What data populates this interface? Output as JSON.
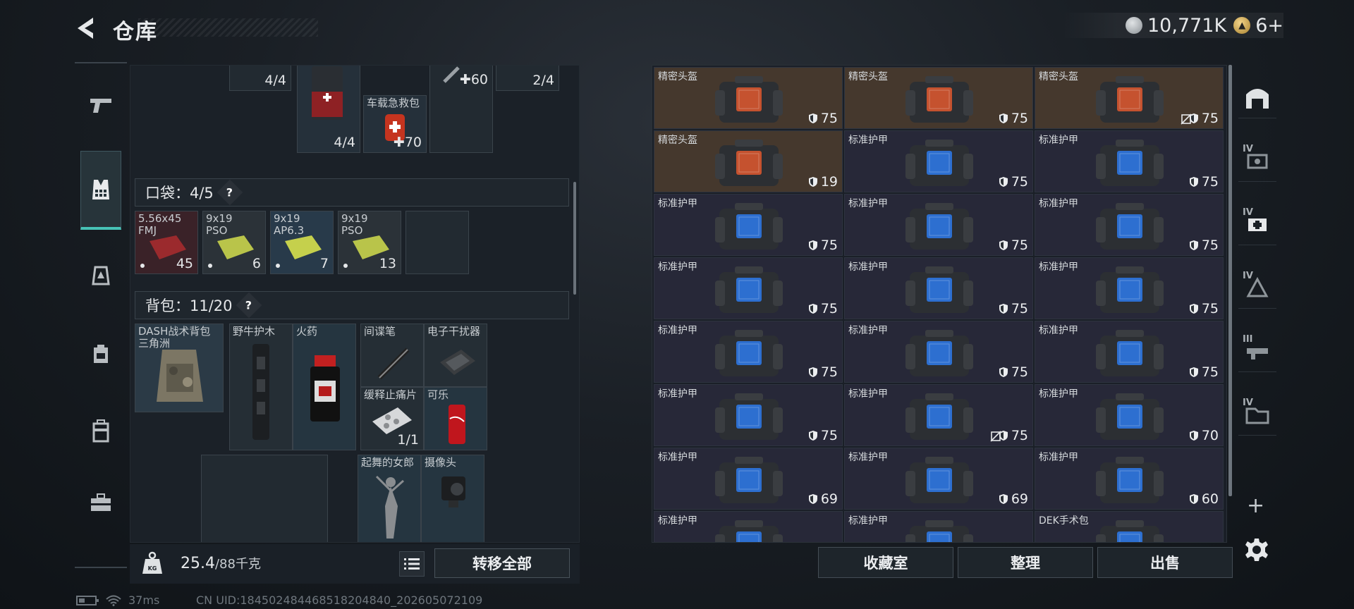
{
  "header": {
    "title": "仓库",
    "silver": "10,771K",
    "gold": "6+"
  },
  "left": {
    "top_slots": [
      {
        "count": "4/4"
      },
      {
        "count": "4/4"
      },
      {
        "label": "车载急救包",
        "count": "70"
      },
      {
        "count": "60"
      },
      {
        "count": "2/4"
      }
    ],
    "pocket": {
      "label": "口袋：",
      "count": "4/5",
      "help": "?"
    },
    "pocket_items": [
      {
        "label": "5.56x45\nFMJ",
        "count": "45",
        "color": "#3a2024"
      },
      {
        "label": "9x19\nPSO",
        "count": "6",
        "color": "#2a3034"
      },
      {
        "label": "9x19\nAP6.3",
        "count": "7",
        "color": "#273846"
      },
      {
        "label": "9x19\nPSO",
        "count": "13",
        "color": "#2a3034"
      }
    ],
    "backpack": {
      "label": "背包：",
      "count": "11/20",
      "help": "?"
    },
    "backpack_items": {
      "dash": "DASH战术背包\n三角洲",
      "handguard": "野牛护木",
      "gunpowder": "火药",
      "spy_pen": "间谍笔",
      "jammer": "电子干扰器",
      "painkiller": "缓释止痛片",
      "painkiller_count": "1/1",
      "cola": "可乐",
      "dancer": "起舞的女郎",
      "camera": "摄像头"
    },
    "weight": "25.4",
    "weight_unit": "/88千克",
    "transfer": "转移全部"
  },
  "right": {
    "cells": [
      {
        "name": "精密头盔",
        "val": "75",
        "kind": "helmet"
      },
      {
        "name": "精密头盔",
        "val": "75",
        "kind": "helmet"
      },
      {
        "name": "精密头盔",
        "val": "75",
        "kind": "helmet",
        "nosign": true
      },
      {
        "name": "精密头盔",
        "val": "19",
        "kind": "helmet"
      },
      {
        "name": "标准护甲",
        "val": "75",
        "kind": "armor"
      },
      {
        "name": "标准护甲",
        "val": "75",
        "kind": "armor"
      },
      {
        "name": "标准护甲",
        "val": "75",
        "kind": "armor"
      },
      {
        "name": "标准护甲",
        "val": "75",
        "kind": "armor"
      },
      {
        "name": "标准护甲",
        "val": "75",
        "kind": "armor"
      },
      {
        "name": "标准护甲",
        "val": "75",
        "kind": "armor"
      },
      {
        "name": "标准护甲",
        "val": "75",
        "kind": "armor"
      },
      {
        "name": "标准护甲",
        "val": "75",
        "kind": "armor"
      },
      {
        "name": "标准护甲",
        "val": "75",
        "kind": "armor"
      },
      {
        "name": "标准护甲",
        "val": "75",
        "kind": "armor"
      },
      {
        "name": "标准护甲",
        "val": "75",
        "kind": "armor"
      },
      {
        "name": "标准护甲",
        "val": "75",
        "kind": "armor"
      },
      {
        "name": "标准护甲",
        "val": "75",
        "kind": "armor",
        "nosign": true
      },
      {
        "name": "标准护甲",
        "val": "70",
        "kind": "armor"
      },
      {
        "name": "标准护甲",
        "val": "69",
        "kind": "armor"
      },
      {
        "name": "标准护甲",
        "val": "69",
        "kind": "armor"
      },
      {
        "name": "标准护甲",
        "val": "60",
        "kind": "armor"
      },
      {
        "name": "标准护甲",
        "val": "",
        "kind": "armor"
      },
      {
        "name": "标准护甲",
        "val": "",
        "kind": "armor"
      },
      {
        "name": "DEK手术包",
        "val": "",
        "kind": "armor"
      }
    ],
    "rail": [
      "IV",
      "IV",
      "IV",
      "III",
      "IV"
    ],
    "tabs": [
      "收藏室",
      "整理",
      "出售"
    ]
  },
  "status": {
    "ping": "37ms",
    "uid": "CN UID:184502484468518204840_202605072109"
  }
}
